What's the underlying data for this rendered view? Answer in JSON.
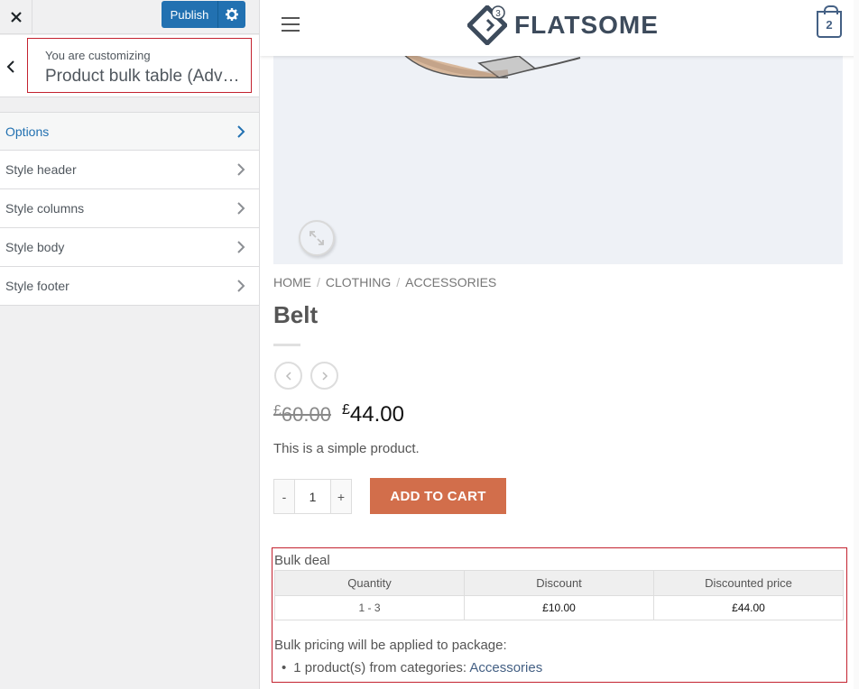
{
  "customizer": {
    "publish_label": "Publish",
    "customizing_label": "You are customizing",
    "section_title": "Product bulk table (Advanced Bulk Pricing)",
    "menu": [
      {
        "label": "Options"
      },
      {
        "label": "Style header"
      },
      {
        "label": "Style columns"
      },
      {
        "label": "Style body"
      },
      {
        "label": "Style footer"
      }
    ]
  },
  "site": {
    "logo_text": "FLATSOME",
    "logo_badge": "3",
    "cart_count": "2"
  },
  "product": {
    "breadcrumb": [
      "HOME",
      "CLOTHING",
      "ACCESSORIES"
    ],
    "title": "Belt",
    "currency": "£",
    "old_price": "60.00",
    "new_price": "44.00",
    "short_description": "This is a simple product.",
    "quantity": "1",
    "qty_minus": "-",
    "qty_plus": "+",
    "add_to_cart": "ADD TO CART"
  },
  "bulk": {
    "title": "Bulk deal",
    "headers": [
      "Quantity",
      "Discount",
      "Discounted price"
    ],
    "rows": [
      {
        "quantity": "1 - 3",
        "discount": "£10.00",
        "discounted_price": "£44.00"
      }
    ],
    "note": "Bulk pricing will be applied to package:",
    "list_prefix": "1 product(s) from categories:",
    "list_link": "Accessories"
  },
  "colors": {
    "accent": "#2271b1",
    "button": "#d26e4b",
    "highlight_border": "#c3222f"
  }
}
